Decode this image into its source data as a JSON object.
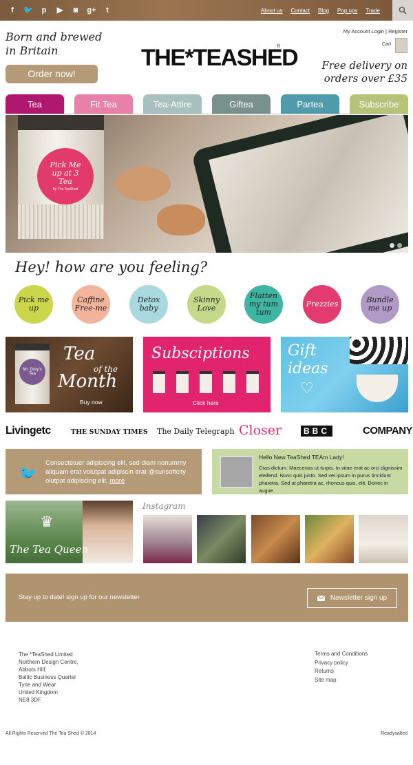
{
  "topbar": {
    "social": [
      {
        "icon": "facebook-icon",
        "glyph": "f"
      },
      {
        "icon": "twitter-icon",
        "glyph": "t"
      },
      {
        "icon": "pinterest-icon",
        "glyph": "p"
      },
      {
        "icon": "youtube-icon",
        "glyph": "▶"
      },
      {
        "icon": "instagram-icon",
        "glyph": "◙"
      },
      {
        "icon": "googleplus-icon",
        "glyph": "g+"
      },
      {
        "icon": "tumblr-icon",
        "glyph": "t"
      }
    ],
    "links": [
      "About us",
      "Contact",
      "Blog",
      "Pop ups",
      "Trade"
    ],
    "search_icon": "search-icon"
  },
  "header": {
    "tagline": "Born and brewed in Britain",
    "order_button": "Order now!",
    "logo": "THE*TEASHED",
    "logo_mark": "®",
    "account": "My Account  Login  |  Register",
    "cart": "Cart",
    "delivery": "Free delivery on orders over £35"
  },
  "nav": [
    {
      "label": "Tea",
      "color": "#b0186f"
    },
    {
      "label": "Fit Tea",
      "color": "#e880a8"
    },
    {
      "label": "Tea-Attire",
      "color": "#a8c0bf"
    },
    {
      "label": "Giftea",
      "color": "#7a908a"
    },
    {
      "label": "Partea",
      "color": "#4f9aab"
    },
    {
      "label": "Subscribe",
      "color": "#b7c27a"
    }
  ],
  "hero": {
    "cup_text": "Pick Me up at 3 Tea",
    "cup_sub": "By The TeaShed"
  },
  "feelings": {
    "title": "Hey! how are you feeling?",
    "items": [
      {
        "label": "Pick me up",
        "color": "#cbd64b"
      },
      {
        "label": "Caffine Free-me",
        "color": "#f2b59c"
      },
      {
        "label": "Detox baby",
        "color": "#a9d8de"
      },
      {
        "label": "Skinny Love",
        "color": "#c4d98a"
      },
      {
        "label": "Flatten my tum tum",
        "color": "#3fb6a4"
      },
      {
        "label": "Prezzies",
        "color": "#e33a6f"
      },
      {
        "label": "Bundle me up",
        "color": "#b19ac6"
      }
    ]
  },
  "promos": {
    "tea_month": {
      "line1": "Tea",
      "line2": "of the",
      "line3": "Month",
      "link": "Buy now",
      "cup": "Mr. Grey's Tea"
    },
    "subscriptions": {
      "title": "Subsciptions",
      "link": "Click here"
    },
    "gift": {
      "line1": "Gift",
      "line2": "ideas"
    }
  },
  "press": [
    "Livingetc",
    "THE SUNDAY TIMES",
    "The Daily Telegraph",
    "Closer",
    "BBC",
    "COMPANY"
  ],
  "twitter": {
    "icon": "twitter-icon",
    "text": "Consectetuer adipiscing elit, sed diam nonummy aliquam erat volutpat adipiscin erat @sunsoftcity olutpat adipiscing elit,",
    "more": "more"
  },
  "news": {
    "title": "Hello New TeaShed TEAm Lady!",
    "text": "Cras dictum. Maecenas ut turpis. In vitae erat ac orci dignissim eleifend. Nunc quis justo. Sed vel ipsum in purus tincidunt pharetra. Sed at pharetra ac, rhoncus quis, elit. Donec in augue.",
    "link": "augue"
  },
  "instagram": {
    "banner": "The Tea Queen",
    "label": "Instagram"
  },
  "newsletter": {
    "text": "Stay up to date! sign up for our newsletter",
    "button": "Newsletter sign up",
    "icon": "envelope-icon"
  },
  "footer": {
    "address": [
      "The *TeaShed Limited",
      "Northern Design Centre,",
      "Abbots Hill,",
      "Baltic Business Quarter",
      "Tyne and Wear",
      "United Kingdom",
      "NE8 3DF"
    ],
    "links": [
      "Terms and Conditions",
      "Privacy policy",
      "Returns",
      "Site map"
    ],
    "copyright": "All Rights Reserved The Tea Shed © 2014",
    "credit": "Readysalted"
  }
}
